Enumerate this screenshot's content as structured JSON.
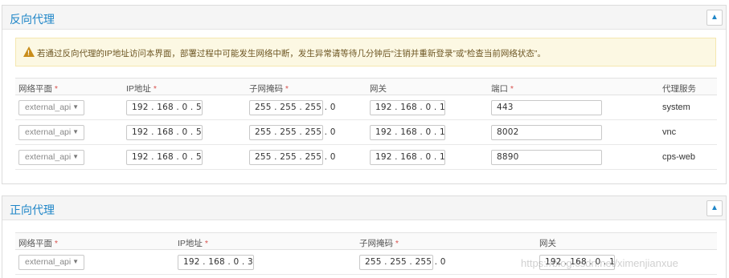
{
  "reverse_proxy": {
    "title": "反向代理",
    "collapse_icon": "chevron-up-icon",
    "alert_text": "若通过反向代理的IP地址访问本界面，部署过程中可能发生网络中断，发生异常请等待几分钟后“注销并重新登录”或“检查当前网络状态”。",
    "headers": {
      "plane": "网络平面",
      "ip": "IP地址",
      "mask": "子网掩码",
      "gateway": "网关",
      "port": "端口",
      "service": "代理服务",
      "required_mark": "*"
    },
    "rows": [
      {
        "plane": "external_api",
        "ip": "192 . 168 . 0 . 5",
        "mask": "255 . 255 . 255 . 0",
        "gateway": "192 . 168 . 0 . 1",
        "port": "443",
        "service": "system"
      },
      {
        "plane": "external_api",
        "ip": "192 . 168 . 0 . 5",
        "mask": "255 . 255 . 255 . 0",
        "gateway": "192 . 168 . 0 . 1",
        "port": "8002",
        "service": "vnc"
      },
      {
        "plane": "external_api",
        "ip": "192 . 168 . 0 . 5",
        "mask": "255 . 255 . 255 . 0",
        "gateway": "192 . 168 . 0 . 1",
        "port": "8890",
        "service": "cps-web"
      }
    ]
  },
  "forward_proxy": {
    "title": "正向代理",
    "collapse_icon": "chevron-up-icon",
    "headers": {
      "plane": "网络平面",
      "ip": "IP地址",
      "mask": "子网掩码",
      "gateway": "网关",
      "required_mark": "*"
    },
    "rows": [
      {
        "plane": "external_api",
        "ip": "192 . 168 . 0 . 3",
        "mask": "255 . 255 . 255 . 0",
        "gateway": "192 . 168 . 0 . 1"
      }
    ]
  },
  "watermark": "https://blog.csdn.net/ximenjianxue"
}
